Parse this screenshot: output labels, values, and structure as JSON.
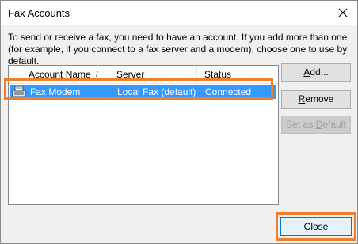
{
  "window": {
    "title": "Fax Accounts",
    "close_glyph": "✕"
  },
  "description": "To send or receive a fax, you need to have an account. If you add more than one (for example, if you connect to a fax server and a modem), choose one to use by default.",
  "list": {
    "columns": [
      "Account Name",
      "Server",
      "Status"
    ],
    "sort_indicator": "/",
    "rows": [
      {
        "account": "Fax Modem",
        "server": "Local Fax (default)",
        "status": "Connected",
        "icon": "fax-modem-icon",
        "selected": true
      }
    ]
  },
  "buttons": {
    "add": {
      "prefix": "",
      "mnemonic": "A",
      "suffix": "dd..."
    },
    "remove": {
      "prefix": "",
      "mnemonic": "R",
      "suffix": "emove"
    },
    "set_default": {
      "prefix": "Set as ",
      "mnemonic": "D",
      "suffix": "efault"
    },
    "close": "Close"
  },
  "colors": {
    "highlight": "#f07e2a",
    "selection": "#3399ff"
  }
}
